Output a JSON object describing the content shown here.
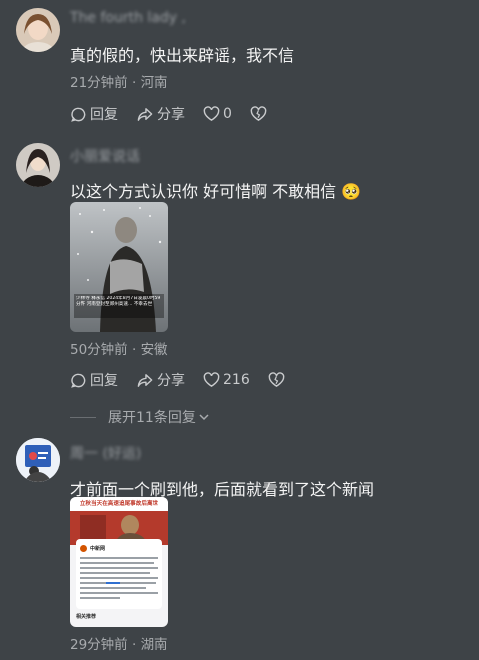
{
  "comments": [
    {
      "username": "The fourth lady ,",
      "text": "真的假的，快出来辟谣，我不信",
      "time": "21分钟前",
      "location": "河南",
      "reply_label": "回复",
      "share_label": "分享",
      "likes": "0"
    },
    {
      "username": "小丽爱说话",
      "text": "以这个方式认识你 好可惜啊 不敢相信",
      "emoji": "🥺",
      "time": "50分钟前",
      "location": "安徽",
      "reply_label": "回复",
      "share_label": "分享",
      "likes": "216",
      "image_caption": "少林寺 释永信 2024年8月7日凌晨0时59分许 河南登封至郑州高速... 不幸去世"
    },
    {
      "username": "周一 (好运)",
      "text": "才前面一个刷到他，后面就看到了这个新闻",
      "time": "29分钟前",
      "location": "湖南",
      "image_title": "立秋当天在高速追尾事故后离世",
      "image_source": "中新网",
      "image_related": "相关推荐"
    }
  ],
  "expand_replies": "展开11条回复",
  "colors": {
    "background": "#3e4347",
    "text": "#f4f4f4",
    "meta": "#a8abae"
  }
}
